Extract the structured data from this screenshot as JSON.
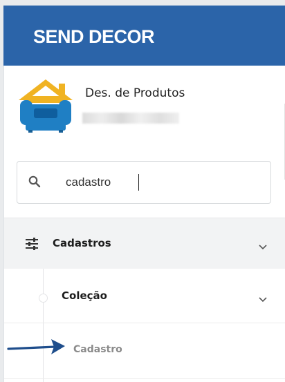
{
  "header": {
    "brand": "SEND DECOR",
    "brand_color": "#2b64a9"
  },
  "user": {
    "name": "Des. de Produtos",
    "avatar_icon": "sofa-house-icon"
  },
  "search": {
    "value": "cadastro",
    "icon": "search-icon"
  },
  "menu": {
    "cadastros": {
      "label": "Cadastros",
      "icon": "sliders-icon",
      "expanded": true
    },
    "colecao": {
      "label": "Coleção",
      "expanded": true
    },
    "cadastro": {
      "label": "Cadastro"
    }
  },
  "annotation": {
    "icon": "arrow-right-icon",
    "color": "#1f4e8c"
  }
}
